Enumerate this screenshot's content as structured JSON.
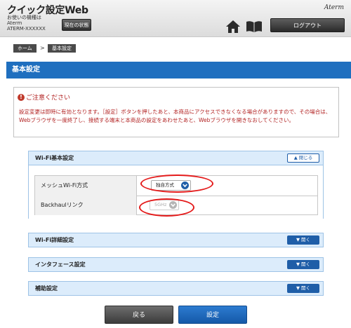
{
  "header": {
    "app_title": "クイック設定Web",
    "model_caption": "お使いの機種は",
    "model_name": "Aterm",
    "model_id": "ATERM-XXXXXX",
    "status_button": "現在の状態",
    "brand_logo": "Aterm",
    "logout_button": "ログアウト",
    "icons": [
      "home-icon",
      "manual-book-icon"
    ]
  },
  "breadcrumb": {
    "home": "ホーム",
    "separator": ">",
    "current": "基本設定"
  },
  "page_title": "基本設定",
  "caution": {
    "title": "ご注意ください",
    "text": "設定変更は即時に有効となります。［設定］ボタンを押したあと、本商品にアクセスできなくなる場合がありますので、その場合は、Webブラウザを一度終了し、接続する端末と本商品の設定をあわせたあと、Webブラウザを開きなおしてください。",
    "color": "#b22222"
  },
  "panels": {
    "wifi_basic": {
      "title": "Wi-Fi基本設定",
      "toggle": "閉じる",
      "rows": [
        {
          "label": "メッシュWi-Fi方式",
          "value": "独自方式",
          "enabled": true
        },
        {
          "label": "Backhaulリンク",
          "value": "5GHz",
          "enabled": false
        }
      ]
    },
    "wifi_detail": {
      "title": "Wi-Fi詳細設定",
      "toggle": "開く"
    },
    "interface": {
      "title": "インタフェース設定",
      "toggle": "開く"
    },
    "auxiliary": {
      "title": "補助設定",
      "toggle": "開く"
    }
  },
  "buttons": {
    "back": "戻る",
    "apply": "設定"
  },
  "colors": {
    "accent": "#1f6fbf",
    "panel_header": "#dcecfb",
    "highlight_ring": "#e41b1b"
  }
}
